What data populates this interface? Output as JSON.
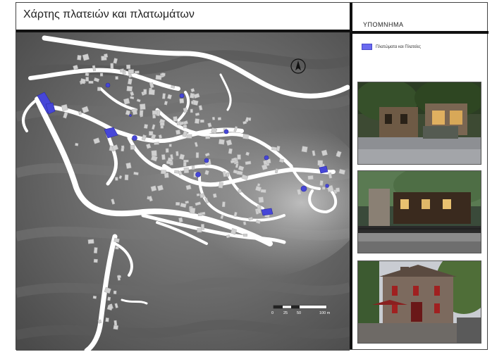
{
  "title": "Χάρτης πλατειών και πλατωμάτων",
  "legend": {
    "heading": "ΥΠΟΜΝΗΜΑ",
    "items": [
      {
        "label": "Πλατώματα και Πλατείες",
        "color": "#6a6af0"
      }
    ]
  },
  "map": {
    "background_dark": "#4a4a4a",
    "road_color": "#ffffff",
    "square_color": "#4646d8",
    "building_color": "#cfcfcf",
    "north_icon": "north-arrow-icon",
    "scale_bar": {
      "labels": [
        "0",
        "25",
        "50",
        "100 m"
      ]
    }
  },
  "photos": [
    {
      "name": "photo-square-street"
    },
    {
      "name": "photo-cafe-pergola"
    },
    {
      "name": "photo-stone-house"
    }
  ]
}
